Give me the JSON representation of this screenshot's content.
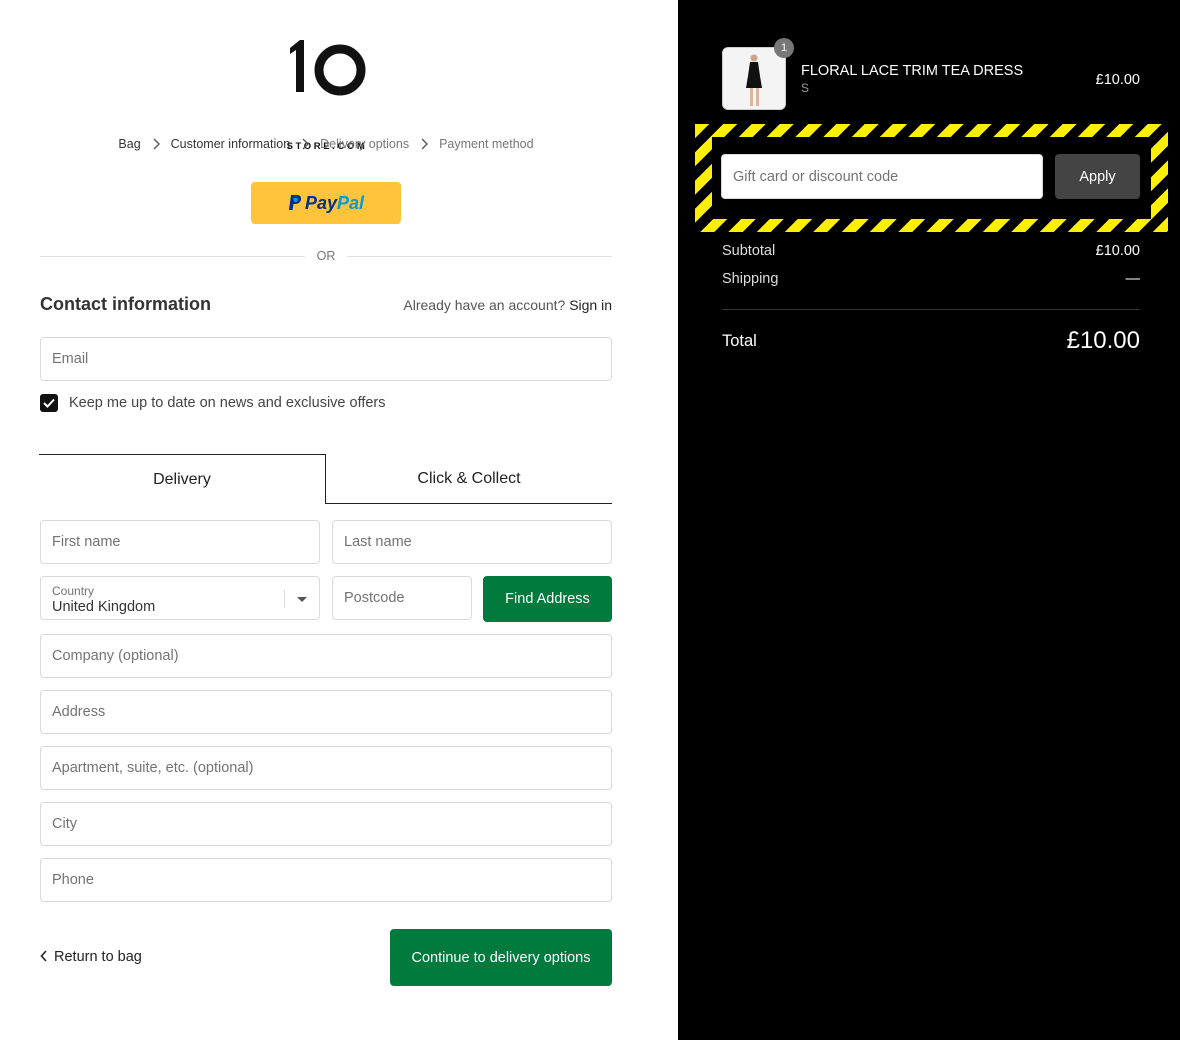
{
  "brand": {
    "logo_text": "STORE.COM"
  },
  "breadcrumb": {
    "items": [
      {
        "label": "Bag"
      },
      {
        "label": "Customer information"
      },
      {
        "label": "Delivery options"
      },
      {
        "label": "Payment method"
      }
    ]
  },
  "paypal": {
    "word1": "Pay",
    "word2": "Pal"
  },
  "divider": {
    "or_label": "OR"
  },
  "contact": {
    "title": "Contact information",
    "account_prompt": "Already have an account?",
    "sign_in_label": "Sign in",
    "email_placeholder": "Email",
    "newsletter_label": "Keep me up to date on news and exclusive offers",
    "newsletter_checked": true
  },
  "tabs": {
    "delivery": "Delivery",
    "click_collect": "Click & Collect"
  },
  "address_form": {
    "first_name_placeholder": "First name",
    "last_name_placeholder": "Last name",
    "country_label": "Country",
    "country_value": "United Kingdom",
    "postcode_placeholder": "Postcode",
    "find_address_label": "Find Address",
    "company_placeholder": "Company (optional)",
    "address_placeholder": "Address",
    "apartment_placeholder": "Apartment, suite, etc. (optional)",
    "city_placeholder": "City",
    "phone_placeholder": "Phone"
  },
  "footer_actions": {
    "return_label": "Return to bag",
    "continue_label": "Continue to delivery options"
  },
  "order_summary": {
    "item": {
      "quantity": "1",
      "name": "FLORAL LACE TRIM TEA DRESS",
      "variant": "S",
      "price": "£10.00"
    },
    "discount": {
      "placeholder": "Gift card or discount code",
      "apply_label": "Apply"
    },
    "subtotal_label": "Subtotal",
    "subtotal_value": "£10.00",
    "shipping_label": "Shipping",
    "shipping_value": "—",
    "total_label": "Total",
    "total_value": "£10.00"
  },
  "colors": {
    "primary_green": "#007a3d",
    "paypal_yellow": "#ffc439",
    "hazard_yellow": "#ffef00",
    "summary_bg": "#000000"
  }
}
